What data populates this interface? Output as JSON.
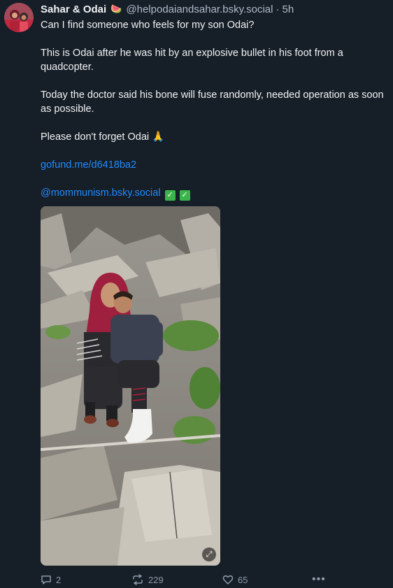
{
  "author": {
    "display_name": "Sahar & Odai",
    "emoji": "🍉",
    "handle": "@helpodaiandsahar.bsky.social",
    "separator": "·",
    "time": "5h"
  },
  "post": {
    "line1": "Can I find someone who feels for my son Odai?",
    "line2": "This is Odai after he was hit by an explosive bullet in his foot from a quadcopter.",
    "line3": "Today the doctor said his bone will fuse randomly, needed  operation as soon as possible.",
    "line4": "Please don't forget Odai 🙏",
    "link": "gofund.me/d6418ba2",
    "mention": "@mommunism.bsky.social",
    "check_mark": "✓"
  },
  "actions": {
    "replies": "2",
    "reposts": "229",
    "likes": "65",
    "more": "•••"
  },
  "colors": {
    "background": "#161e27",
    "text": "#f1f3f5",
    "muted": "#aebbc9",
    "link": "#208bfe",
    "check": "#3bb54a"
  },
  "icons": {
    "reply": "reply-icon",
    "repost": "repost-icon",
    "like": "heart-icon",
    "more": "more-icon",
    "expand": "expand-icon"
  }
}
